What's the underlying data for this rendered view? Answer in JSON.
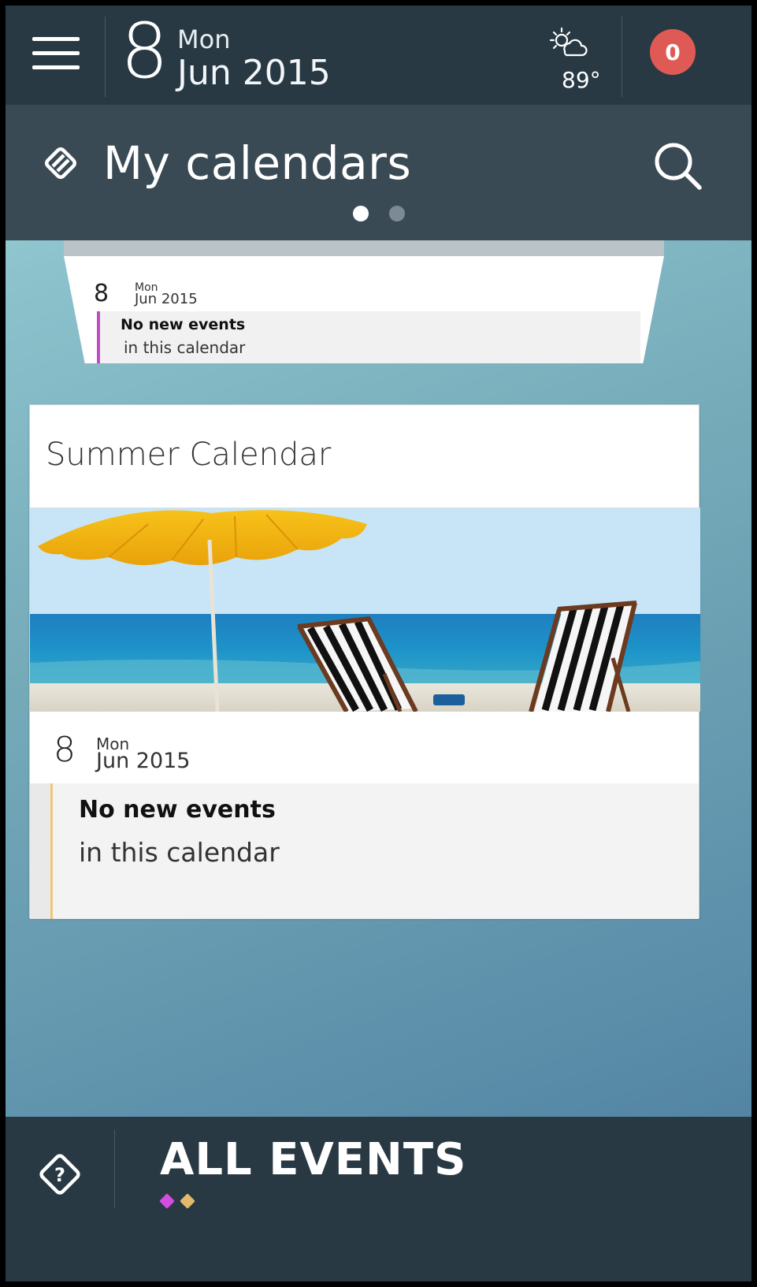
{
  "topbar": {
    "day_number": "8",
    "day_name": "Mon",
    "month_year": "Jun 2015",
    "temperature": "89°",
    "weather_icon": "partly-sunny-icon",
    "notification_count": "0",
    "badge_color": "#e05a55"
  },
  "header": {
    "title": "My calendars",
    "icon": "calendars-icon",
    "search_icon": "search-icon",
    "page_dots": [
      {
        "active": true
      },
      {
        "active": false
      }
    ]
  },
  "calendars": [
    {
      "day_number": "8",
      "day_name": "Mon",
      "month_year": "Jun 2015",
      "no_events": "No new events",
      "subtitle": "in this calendar",
      "accent_color": "#c24bc6"
    },
    {
      "title": "Summer Calendar",
      "day_number": "8",
      "day_name": "Mon",
      "month_year": "Jun 2015",
      "no_events": "No new events",
      "subtitle": "in this calendar",
      "accent_color": "#efc77a"
    }
  ],
  "bottombar": {
    "title": "ALL EVENTS",
    "help_icon": "help-icon",
    "calendar_colors": [
      "#d24de0",
      "#e6b96a"
    ]
  },
  "colors": {
    "bar_dark": "#283944",
    "header_band": "#3a4a55"
  }
}
